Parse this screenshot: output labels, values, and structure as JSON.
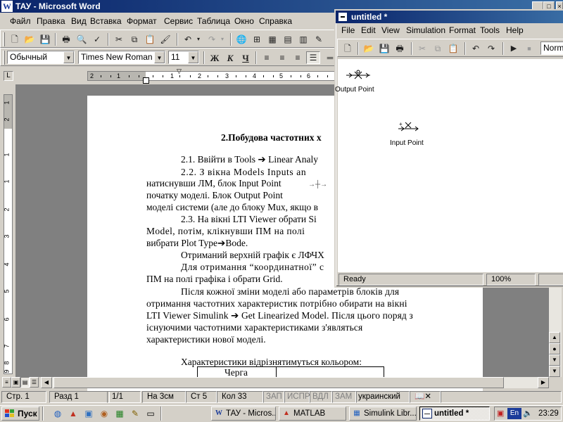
{
  "word": {
    "title": "ТАУ - Microsoft Word",
    "title_controls": [
      "_",
      "□",
      "×"
    ],
    "menu": [
      "Файл",
      "Правка",
      "Вид",
      "Вставка",
      "Формат",
      "Сервис",
      "Таблица",
      "Окно",
      "Справка"
    ],
    "format_bar": {
      "style": "Обычный",
      "font": "Times New Roman",
      "size": "11",
      "bold": "Ж",
      "italic": "К",
      "underline": "Ч"
    },
    "ruler_numbers": [
      "2",
      "1",
      "1",
      "2",
      "3",
      "4",
      "5",
      "6",
      "7",
      "8",
      "9",
      "10",
      "11"
    ],
    "vruler_numbers": [
      "1",
      "2",
      "1",
      "1",
      "2",
      "3",
      "4",
      "5",
      "6",
      "7",
      "8",
      "9"
    ],
    "document": {
      "heading": "2.Побудова частотних х",
      "lines": [
        "2.1. Ввійти в Tools ➔ Linear Analy",
        "2.2.  З  вікна  Models  Inputs  an",
        "натиснувши ЛМ, блок Input Point",
        "початку моделі. Блок Output Point",
        "моделі системи (але до блоку Mux, якщо в",
        "2.3. На вікні LTI Viewer обрати Si",
        "Model,  потім,  клікнувши  ПМ  на  полі",
        "вибрати Plot Type➔Bode.",
        "Отриманий верхній графік є ЛФЧХ",
        "Для  отримання  “координатної”  с",
        "ПМ на полі графіка і обрати Grid.",
        "Після кожної зміни моделі або параметрів блоків для",
        "отримання частотних характеристик потрібно обирати на вікні",
        "LTI Viewer Simulink ➔ Get Linearized Model. Після цього поряд з",
        "існуючими        частотними        характеристиками        з'являться",
        "характеристики нової моделі.",
        "Характеристики відрізнятимуться кольором:"
      ],
      "table_header": "Черга"
    },
    "status": {
      "page": "Стр. 1",
      "section": "Разд 1",
      "pages": "1/1",
      "at": "На 3см",
      "line": "Ст 5",
      "column": "Кол 33",
      "rec": "ЗАП",
      "trk": "ИСПР",
      "ext": "ВДЛ",
      "ovr": "ЗАМ",
      "language": "украинский"
    }
  },
  "simulink": {
    "title": "untitled *",
    "menu": [
      "File",
      "Edit",
      "View",
      "Simulation",
      "Format",
      "Tools",
      "Help"
    ],
    "sim_mode": "Norma",
    "blocks": {
      "output_point": "Output Point",
      "input_point": "Input Point"
    },
    "status": {
      "state": "Ready",
      "zoom": "100%"
    }
  },
  "taskbar": {
    "start": "Пуск",
    "tasks": [
      "ТАУ - Micros...",
      "MATLAB",
      "Simulink Libr...",
      "untitled *"
    ],
    "lang": "En",
    "clock": "23:29"
  },
  "colors": {
    "title_active": "#0a246a",
    "title_gradient_end": "#3a6ea5",
    "face": "#d4d0c8",
    "spell_error": "#e02020"
  }
}
